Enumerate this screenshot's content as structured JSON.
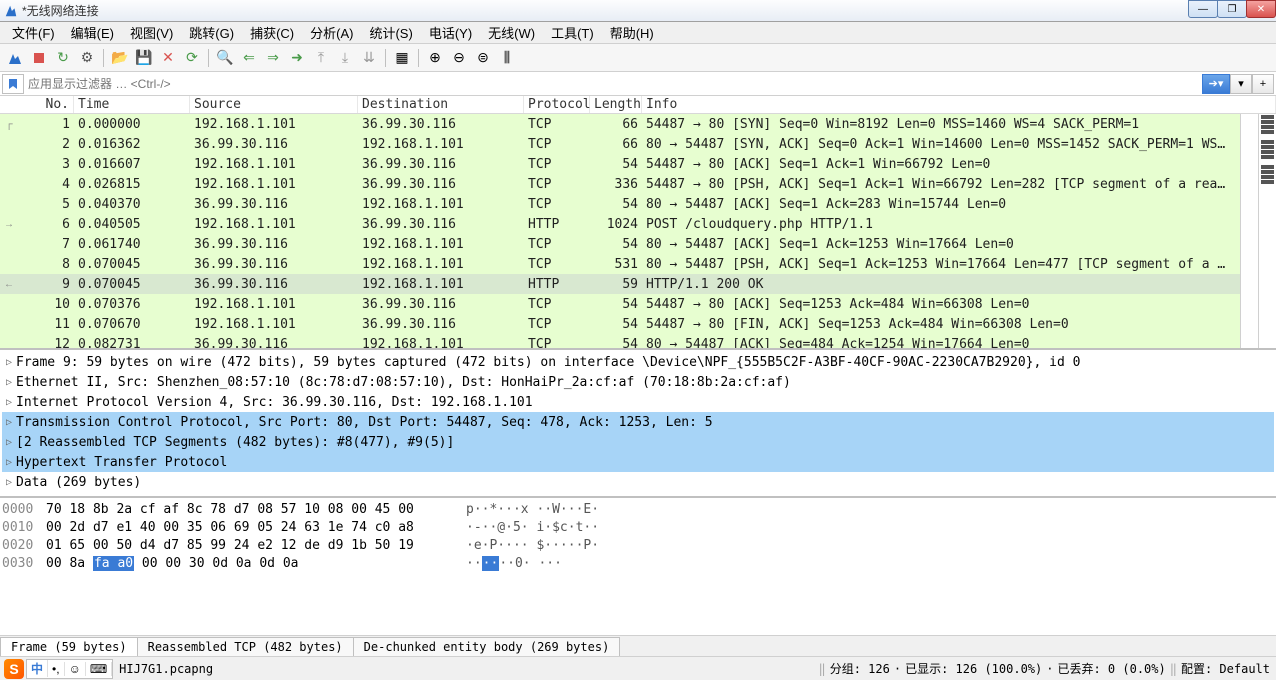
{
  "window": {
    "title": "*无线网络连接"
  },
  "menu": {
    "file": "文件(F)",
    "edit": "编辑(E)",
    "view": "视图(V)",
    "go": "跳转(G)",
    "capture": "捕获(C)",
    "analyze": "分析(A)",
    "statistics": "统计(S)",
    "telephony": "电话(Y)",
    "wireless": "无线(W)",
    "tools": "工具(T)",
    "help": "帮助(H)"
  },
  "filter": {
    "placeholder": "应用显示过滤器 … <Ctrl-/>"
  },
  "columns": {
    "no": "No.",
    "time": "Time",
    "source": "Source",
    "destination": "Destination",
    "protocol": "Protocol",
    "length": "Length",
    "info": "Info"
  },
  "packets": [
    {
      "no": "1",
      "time": "0.000000",
      "src": "192.168.1.101",
      "dst": "36.99.30.116",
      "proto": "TCP",
      "len": "66",
      "info": "54487 → 80 [SYN] Seq=0 Win=8192 Len=0 MSS=1460 WS=4 SACK_PERM=1"
    },
    {
      "no": "2",
      "time": "0.016362",
      "src": "36.99.30.116",
      "dst": "192.168.1.101",
      "proto": "TCP",
      "len": "66",
      "info": "80 → 54487 [SYN, ACK] Seq=0 Ack=1 Win=14600 Len=0 MSS=1452 SACK_PERM=1 WS…"
    },
    {
      "no": "3",
      "time": "0.016607",
      "src": "192.168.1.101",
      "dst": "36.99.30.116",
      "proto": "TCP",
      "len": "54",
      "info": "54487 → 80 [ACK] Seq=1 Ack=1 Win=66792 Len=0"
    },
    {
      "no": "4",
      "time": "0.026815",
      "src": "192.168.1.101",
      "dst": "36.99.30.116",
      "proto": "TCP",
      "len": "336",
      "info": "54487 → 80 [PSH, ACK] Seq=1 Ack=1 Win=66792 Len=282 [TCP segment of a rea…"
    },
    {
      "no": "5",
      "time": "0.040370",
      "src": "36.99.30.116",
      "dst": "192.168.1.101",
      "proto": "TCP",
      "len": "54",
      "info": "80 → 54487 [ACK] Seq=1 Ack=283 Win=15744 Len=0"
    },
    {
      "no": "6",
      "time": "0.040505",
      "src": "192.168.1.101",
      "dst": "36.99.30.116",
      "proto": "HTTP",
      "len": "1024",
      "info": "POST /cloudquery.php HTTP/1.1"
    },
    {
      "no": "7",
      "time": "0.061740",
      "src": "36.99.30.116",
      "dst": "192.168.1.101",
      "proto": "TCP",
      "len": "54",
      "info": "80 → 54487 [ACK] Seq=1 Ack=1253 Win=17664 Len=0"
    },
    {
      "no": "8",
      "time": "0.070045",
      "src": "36.99.30.116",
      "dst": "192.168.1.101",
      "proto": "TCP",
      "len": "531",
      "info": "80 → 54487 [PSH, ACK] Seq=1 Ack=1253 Win=17664 Len=477 [TCP segment of a …"
    },
    {
      "no": "9",
      "time": "0.070045",
      "src": "36.99.30.116",
      "dst": "192.168.1.101",
      "proto": "HTTP",
      "len": "59",
      "info": "HTTP/1.1 200 OK",
      "selected": true
    },
    {
      "no": "10",
      "time": "0.070376",
      "src": "192.168.1.101",
      "dst": "36.99.30.116",
      "proto": "TCP",
      "len": "54",
      "info": "54487 → 80 [ACK] Seq=1253 Ack=484 Win=66308 Len=0"
    },
    {
      "no": "11",
      "time": "0.070670",
      "src": "192.168.1.101",
      "dst": "36.99.30.116",
      "proto": "TCP",
      "len": "54",
      "info": "54487 → 80 [FIN, ACK] Seq=1253 Ack=484 Win=66308 Len=0"
    },
    {
      "no": "12",
      "time": "0.082731",
      "src": "36.99.30.116",
      "dst": "192.168.1.101",
      "proto": "TCP",
      "len": "54",
      "info": "80 → 54487 [ACK] Seq=484 Ack=1254 Win=17664 Len=0"
    }
  ],
  "details": [
    {
      "text": "Frame 9: 59 bytes on wire (472 bits), 59 bytes captured (472 bits) on interface \\Device\\NPF_{555B5C2F-A3BF-40CF-90AC-2230CA7B2920}, id 0",
      "hl": false
    },
    {
      "text": "Ethernet II, Src: Shenzhen_08:57:10 (8c:78:d7:08:57:10), Dst: HonHaiPr_2a:cf:af (70:18:8b:2a:cf:af)",
      "hl": false
    },
    {
      "text": "Internet Protocol Version 4, Src: 36.99.30.116, Dst: 192.168.1.101",
      "hl": false
    },
    {
      "text": "Transmission Control Protocol, Src Port: 80, Dst Port: 54487, Seq: 478, Ack: 1253, Len: 5",
      "hl": true
    },
    {
      "text": "[2 Reassembled TCP Segments (482 bytes): #8(477), #9(5)]",
      "hl": true
    },
    {
      "text": "Hypertext Transfer Protocol",
      "hl": true
    },
    {
      "text": "Data (269 bytes)",
      "hl": false
    }
  ],
  "hex": [
    {
      "offset": "0000",
      "bytes": "70 18 8b 2a cf af 8c 78  d7 08 57 10 08 00 45 00",
      "ascii": "p··*···x ··W···E·"
    },
    {
      "offset": "0010",
      "bytes": "00 2d d7 e1 40 00 35 06  69 05 24 63 1e 74 c0 a8",
      "ascii": "·-··@·5· i·$c·t··"
    },
    {
      "offset": "0020",
      "bytes": "01 65 00 50 d4 d7 85 99  24 e2 12 de d9 1b 50 19",
      "ascii": "·e·P···· $·····P·"
    },
    {
      "offset": "0030",
      "bytes_pre": "00 8a ",
      "bytes_hl": "fa a0",
      "bytes_post": " 00 00 30 0d  0a 0d 0a",
      "ascii_pre": "··",
      "ascii_hl": "··",
      "ascii_post": "··0· ···"
    }
  ],
  "bottom_tabs": {
    "frame": "Frame (59 bytes)",
    "reassembled": "Reassembled TCP (482 bytes)",
    "dechunked": "De-chunked entity body (269 bytes)"
  },
  "status": {
    "filename": "HIJ7G1.pcapng",
    "packets": "分组: 126",
    "displayed": "已显示: 126 (100.0%)",
    "dropped": "已丢弃: 0 (0.0%)",
    "profile": "配置: Default"
  },
  "ime": {
    "zhong": "中",
    "dot": "•,",
    "smile": "☺",
    "grid": "⌨"
  }
}
